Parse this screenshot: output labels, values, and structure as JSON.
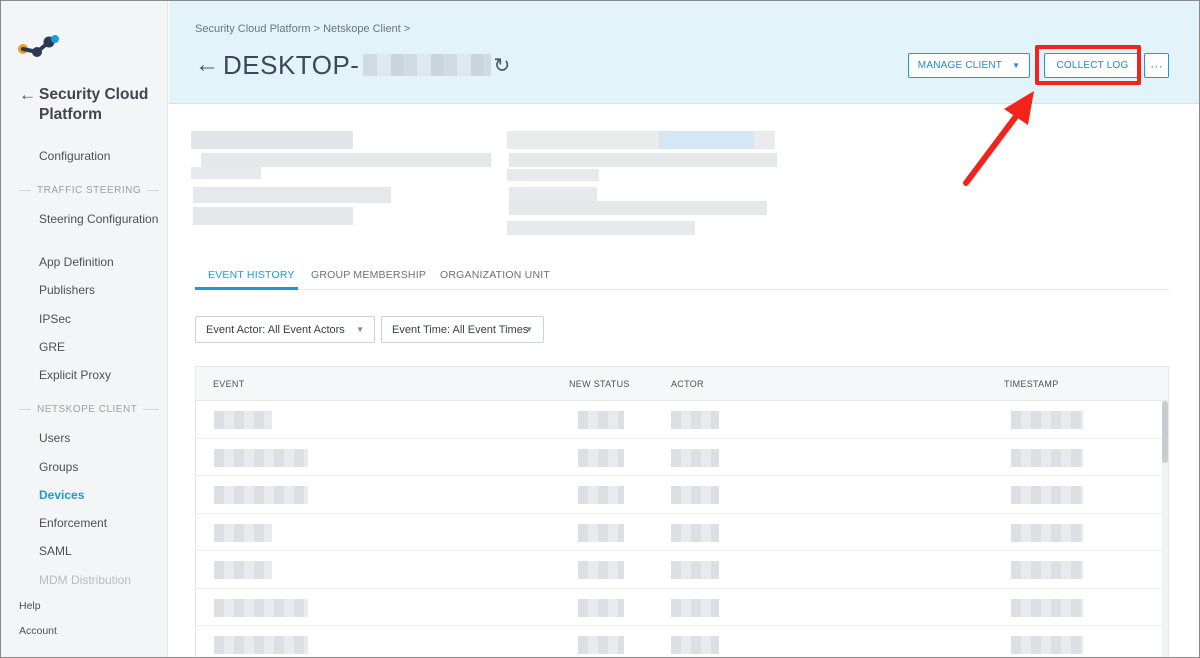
{
  "sidebar": {
    "platform_title": "Security Cloud Platform",
    "items": {
      "configuration": "Configuration",
      "steering_configuration": "Steering Configuration",
      "app_definition": "App Definition",
      "publishers": "Publishers",
      "ipsec": "IPSec",
      "gre": "GRE",
      "explicit_proxy": "Explicit Proxy",
      "users": "Users",
      "groups": "Groups",
      "devices": "Devices",
      "enforcement": "Enforcement",
      "saml": "SAML",
      "mdm_distribution": "MDM Distribution"
    },
    "sections": {
      "traffic_steering": "TRAFFIC STEERING",
      "netskope_client": "NETSKOPE CLIENT"
    },
    "active_item": "Devices",
    "footer": {
      "help": "Help",
      "account": "Account"
    }
  },
  "header": {
    "breadcrumb": "Security Cloud Platform > Netskope Client >",
    "title": "DESKTOP-",
    "buttons": {
      "manage_client": "MANAGE CLIENT",
      "collect_log": "COLLECT LOG",
      "more": "···"
    }
  },
  "tabs": {
    "event_history": "EVENT HISTORY",
    "group_membership": "GROUP MEMBERSHIP",
    "organization_unit": "ORGANIZATION UNIT",
    "active": "EVENT HISTORY"
  },
  "filters": {
    "event_actor": "Event Actor: All Event Actors",
    "event_time": "Event Time: All Event Times"
  },
  "table": {
    "columns": {
      "event": "EVENT",
      "new_status": "NEW STATUS",
      "actor": "ACTOR",
      "timestamp": "TIMESTAMP"
    }
  },
  "colors": {
    "accent": "#1a9bd7",
    "highlight": "#f2231a",
    "header_bg": "#e3f3fa"
  },
  "icons": {
    "back": "arrow-left-icon",
    "refresh": "refresh-icon",
    "caret": "chevron-down-icon"
  }
}
